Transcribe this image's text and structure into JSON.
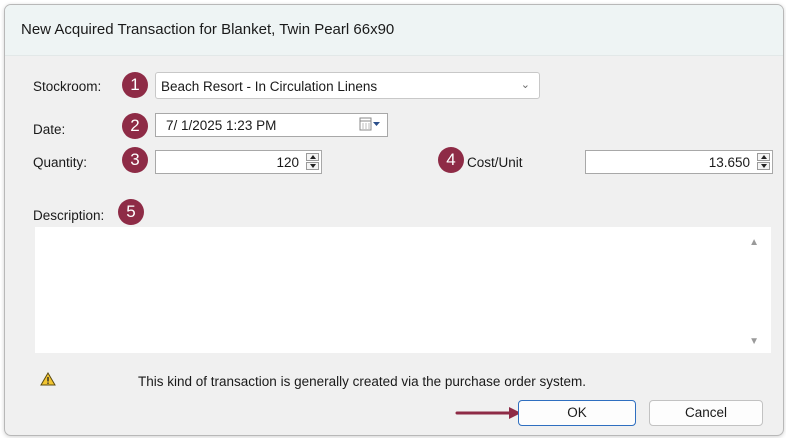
{
  "window": {
    "title": "New Acquired Transaction for Blanket, Twin Pearl 66x90"
  },
  "form": {
    "stockroom_label": "Stockroom:",
    "stockroom_value": "Beach Resort - In Circulation Linens",
    "date_label": "Date:",
    "date_value": "7/  1/2025   1:23 PM",
    "quantity_label": "Quantity:",
    "quantity_value": "120",
    "cost_label": "Cost/Unit",
    "cost_value": "13.650",
    "description_label": "Description:",
    "description_value": ""
  },
  "badges": [
    "1",
    "2",
    "3",
    "4",
    "5"
  ],
  "annotation": {
    "badge_color": "#8e2b46",
    "arrow_color": "#8e2b46"
  },
  "warning": {
    "icon": "warning-icon",
    "text": "This kind of transaction is generally created via the purchase order system."
  },
  "buttons": {
    "ok": "OK",
    "cancel": "Cancel"
  }
}
